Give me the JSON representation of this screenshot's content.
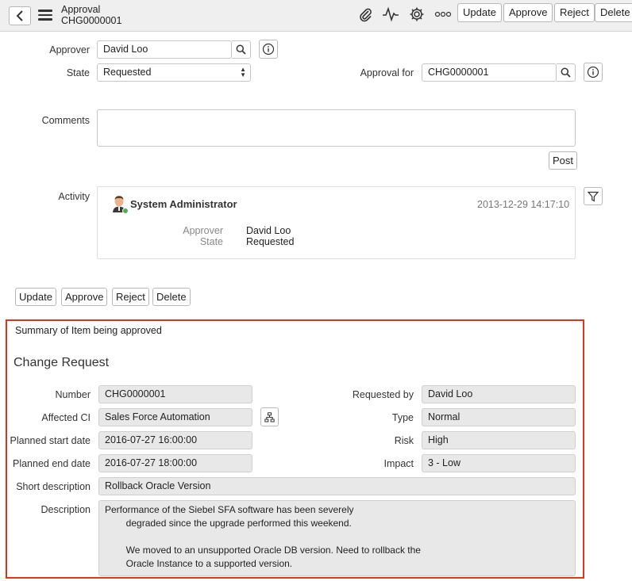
{
  "header": {
    "title": "Approval",
    "subtitle": "CHG0000001",
    "buttons": [
      "Update",
      "Approve",
      "Reject",
      "Delete"
    ],
    "icons": [
      "paperclip-icon",
      "activity-pulse-icon",
      "gear-icon",
      "more-icon"
    ]
  },
  "form": {
    "approver_label": "Approver",
    "approver_value": "David Loo",
    "state_label": "State",
    "state_value": "Requested",
    "approval_for_label": "Approval for",
    "approval_for_value": "CHG0000001",
    "comments_label": "Comments",
    "comments_value": "",
    "post_label": "Post",
    "activity_label": "Activity"
  },
  "activity": {
    "author": "System Administrator",
    "timestamp": "2013-12-29 14:17:10",
    "changes": [
      {
        "field": "Approver",
        "value": "David Loo"
      },
      {
        "field": "State",
        "value": "Requested"
      }
    ]
  },
  "bottom_buttons": [
    "Update",
    "Approve",
    "Reject",
    "Delete"
  ],
  "summary": {
    "title": "Summary of Item being approved",
    "section": "Change Request",
    "number_label": "Number",
    "number_value": "CHG0000001",
    "requested_by_label": "Requested by",
    "requested_by_value": "David Loo",
    "affected_ci_label": "Affected CI",
    "affected_ci_value": "Sales Force Automation",
    "type_label": "Type",
    "type_value": "Normal",
    "planned_start_label": "Planned start date",
    "planned_start_value": "2016-07-27 16:00:00",
    "risk_label": "Risk",
    "risk_value": "High",
    "planned_end_label": "Planned end date",
    "planned_end_value": "2016-07-27 18:00:00",
    "impact_label": "Impact",
    "impact_value": "3 - Low",
    "short_desc_label": "Short description",
    "short_desc_value": "Rollback Oracle Version",
    "description_label": "Description",
    "description_value": "Performance of the Siebel SFA software has been severely\n        degraded since the upgrade performed this weekend.\n\n        We moved to an unsupported Oracle DB version. Need to rollback the\n        Oracle Instance to a supported version."
  },
  "colors": {
    "highlight": "#e1341e",
    "header_bg": "#efefef",
    "readonly_bg": "#e8e8e8"
  }
}
